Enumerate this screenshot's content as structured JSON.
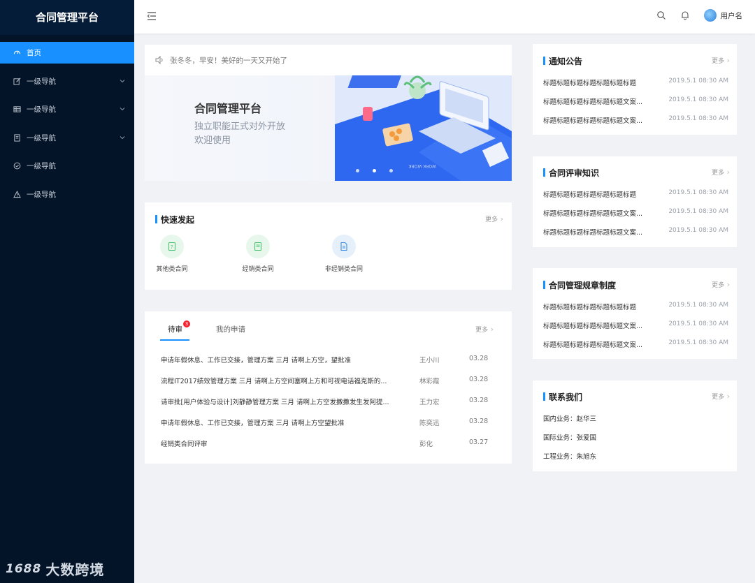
{
  "sidebar": {
    "brand": "合同管理平台",
    "items": [
      {
        "label": "首页",
        "icon": "dashboard-icon"
      },
      {
        "label": "一级导航",
        "icon": "edit-icon"
      },
      {
        "label": "一级导航",
        "icon": "table-icon"
      },
      {
        "label": "一级导航",
        "icon": "file-icon"
      },
      {
        "label": "一级导航",
        "icon": "check-circle-icon"
      },
      {
        "label": "一级导航",
        "icon": "warning-icon"
      }
    ],
    "watermark": "大数跨境",
    "watermark_logo": "1688"
  },
  "header": {
    "username": "用户名"
  },
  "banner": {
    "notice": "张冬冬，早安！美好的一天又开始了",
    "title": "合同管理平台",
    "sub1": "独立职能正式对外开放",
    "sub2": "欢迎使用"
  },
  "quick": {
    "title": "快速发起",
    "more": "更多",
    "items": [
      {
        "label": "其他类合同",
        "color": "#4cc16c",
        "bg": "#e8f7ec"
      },
      {
        "label": "经销类合同",
        "color": "#4cc16c",
        "bg": "#e8f7ec"
      },
      {
        "label": "非经销类合同",
        "color": "#3c8dde",
        "bg": "#e6f0fb"
      }
    ]
  },
  "tasks": {
    "tab1": "待审",
    "badge": "3",
    "tab2": "我的申请",
    "more": "更多",
    "rows": [
      {
        "title": "申请年假休息、工作已交接，管理方案 三月 请啊上方空，望批准",
        "person": "王小川",
        "date": "03.28"
      },
      {
        "title": "流程IT2017绩效管理方案 三月 请啊上方空间塞啊上方和可视电话福克斯的...",
        "person": "林彩霞",
        "date": "03.28"
      },
      {
        "title": "请审批[用户体验与设计]刘静静管理方案 三月 请啊上方空发撒撒发生发阿提...",
        "person": "王力宏",
        "date": "03.28"
      },
      {
        "title": "申请年假休息、工作已交接，管理方案 三月 请啊上方空望批准",
        "person": "陈奕迅",
        "date": "03.28"
      },
      {
        "title": "经销类合同评审",
        "person": "彭化",
        "date": "03.27"
      }
    ]
  },
  "panels": [
    {
      "title": "通知公告",
      "more": "更多",
      "rows": [
        {
          "title": "标题标题标题标题标题标题标题",
          "date": "2019.5.1  08:30 AM"
        },
        {
          "title": "标题标题标题标题标题标题文案...",
          "date": "2019.5.1  08:30 AM"
        },
        {
          "title": "标题标题标题标题标题标题文案...",
          "date": "2019.5.1  08:30 AM"
        }
      ]
    },
    {
      "title": "合同评审知识",
      "more": "更多",
      "rows": [
        {
          "title": "标题标题标题标题标题标题标题",
          "date": "2019.5.1  08:30 AM"
        },
        {
          "title": "标题标题标题标题标题标题文案...",
          "date": "2019.5.1  08:30 AM"
        },
        {
          "title": "标题标题标题标题标题标题文案...",
          "date": "2019.5.1  08:30 AM"
        }
      ]
    },
    {
      "title": "合同管理规章制度",
      "more": "更多",
      "rows": [
        {
          "title": "标题标题标题标题标题标题标题",
          "date": "2019.5.1  08:30 AM"
        },
        {
          "title": "标题标题标题标题标题标题文案...",
          "date": "2019.5.1  08:30 AM"
        },
        {
          "title": "标题标题标题标题标题标题文案...",
          "date": "2019.5.1  08:30 AM"
        }
      ]
    }
  ],
  "contact": {
    "title": "联系我们",
    "more": "更多",
    "rows": [
      "国内业务：赵华三",
      "国际业务：张爱国",
      "工程业务：朱旭东"
    ]
  },
  "colors": {
    "accent": "#1890ff",
    "sidebar": "#031428",
    "badge": "#f5222d"
  }
}
